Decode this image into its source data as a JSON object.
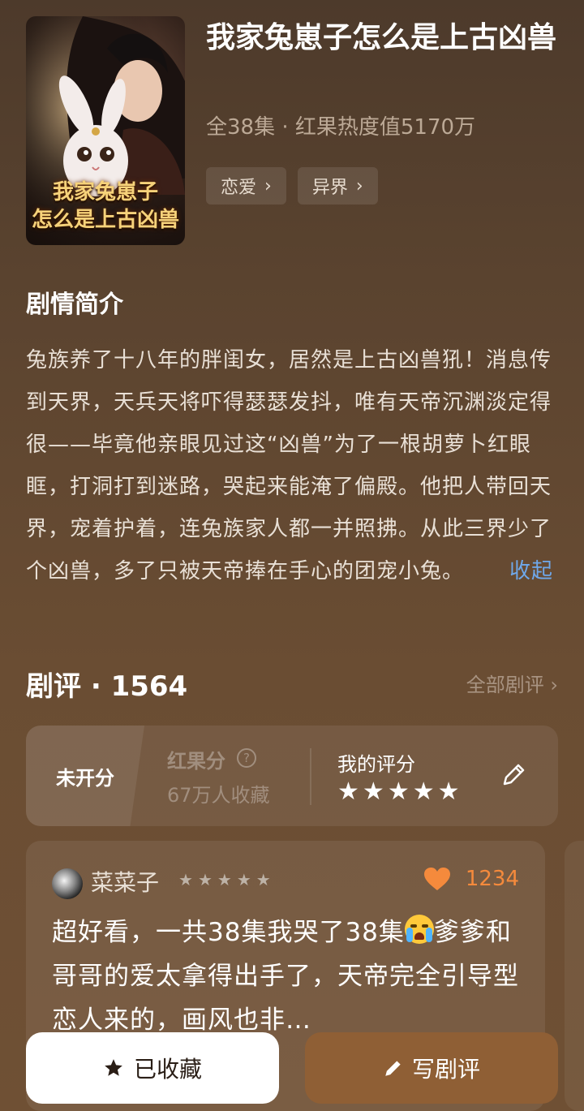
{
  "drama": {
    "title": "我家兔崽子怎么是上古凶兽",
    "cover_title_line1": "我家兔崽子",
    "cover_title_line2": "怎么是上古凶兽",
    "meta": "全38集 · 红果热度值5170万",
    "tags": [
      "恋爱",
      "异界"
    ]
  },
  "synopsis": {
    "heading": "剧情简介",
    "text": "兔族养了十八年的胖闺女，居然是上古凶兽犼！消息传到天界，天兵天将吓得瑟瑟发抖，唯有天帝沉渊淡定得很——毕竟他亲眼见过这“凶兽”为了一根胡萝卜红眼眶，打洞打到迷路，哭起来能淹了偏殿。他把人带回天界，宠着护着，连兔族家人都一并照拂。从此三界少了个凶兽，多了只被天帝捧在手心的团宠小兔。",
    "collapse_label": "收起"
  },
  "reviews": {
    "heading": "剧评 · 1564",
    "all_link": "全部剧评",
    "rating": {
      "unrated_label": "未开分",
      "score_label": "红果分",
      "favorites": "67万人收藏",
      "my_score_label": "我的评分",
      "my_stars": 5
    },
    "items": [
      {
        "user": "菜菜子",
        "stars": 5,
        "likes": "1234",
        "text_part1": "超好看，一共38集我哭了38集",
        "text_part2": "爹爹和哥哥的爱太拿得出手了，天帝完全引导型恋人来的，画风也非…"
      }
    ]
  },
  "actions": {
    "favorited_label": "已收藏",
    "write_review_label": "写剧评"
  },
  "colors": {
    "accent_link": "#6fa8ea",
    "like": "#f58a3c",
    "write_button": "#8f5f35"
  }
}
